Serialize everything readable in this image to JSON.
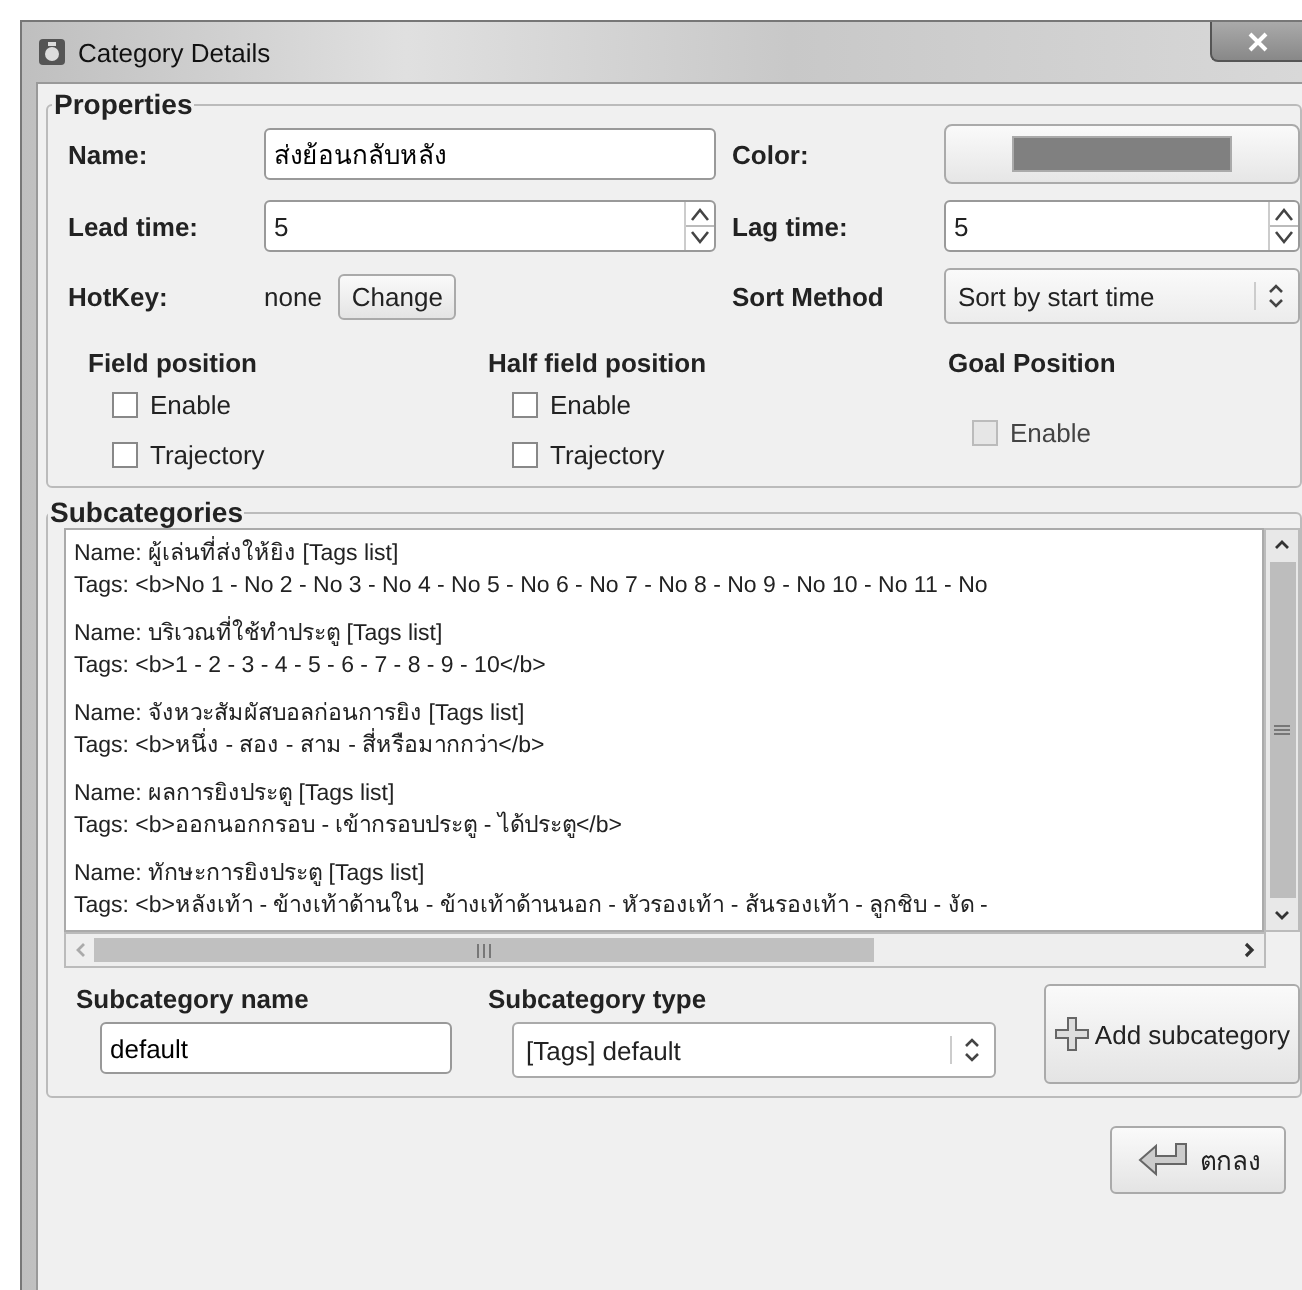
{
  "window": {
    "title": "Category Details"
  },
  "properties": {
    "legend": "Properties",
    "name": {
      "label": "Name:",
      "value": "ส่งย้อนกลับหลัง"
    },
    "color": {
      "label": "Color:",
      "color": "#808080"
    },
    "lead_time": {
      "label": "Lead time:",
      "value": "5"
    },
    "lag_time": {
      "label": "Lag time:",
      "value": "5"
    },
    "hotkey": {
      "label": "HotKey:",
      "value": "none",
      "button": "Change"
    },
    "sort_method": {
      "label": "Sort Method",
      "value": "Sort by start time"
    },
    "positions": [
      {
        "title": "Field position",
        "options": [
          {
            "label": "Enable",
            "checked": false,
            "disabled": false
          },
          {
            "label": "Trajectory",
            "checked": false,
            "disabled": false
          }
        ]
      },
      {
        "title": "Half field position",
        "options": [
          {
            "label": "Enable",
            "checked": false,
            "disabled": false
          },
          {
            "label": "Trajectory",
            "checked": false,
            "disabled": false
          }
        ]
      },
      {
        "title": "Goal Position",
        "options": [
          {
            "label": "Enable",
            "checked": false,
            "disabled": true
          }
        ]
      }
    ]
  },
  "subcategories": {
    "legend": "Subcategories",
    "items": [
      {
        "name_line": "Name: ผู้เล่นที่ส่งให้ยิง [Tags list]",
        "tags_line": "Tags: <b>No 1 - No 2 - No 3 - No 4 - No 5 - No 6 - No 7 - No 8 - No 9 - No 10 - No 11 - No"
      },
      {
        "name_line": "Name: บริเวณที่ใช้ทำประตู [Tags list]",
        "tags_line": "Tags: <b>1  - 2 - 3 - 4 - 5 - 6 - 7 - 8 - 9 - 10</b>"
      },
      {
        "name_line": "Name: จังหวะสัมผัสบอลก่อนการยิง [Tags list]",
        "tags_line": "Tags: <b>หนึ่ง  - สอง - สาม - สี่หรือมากกว่า</b>"
      },
      {
        "name_line": "Name: ผลการยิงประตู [Tags list]",
        "tags_line": "Tags: <b>ออกนอกกรอบ - เข้ากรอบประตู - ได้ประตู</b>"
      },
      {
        "name_line": "Name: ทักษะการยิงประตู [Tags list]",
        "tags_line": "Tags: <b>หลังเท้า - ข้างเท้าด้านใน - ข้างเท้าด้านนอก - หัวรองเท้า - ส้นรองเท้า - ลูกชิบ - งัด -"
      }
    ],
    "name_field": {
      "label": "Subcategory name",
      "value": "default"
    },
    "type_field": {
      "label": "Subcategory type",
      "value": "[Tags] default"
    },
    "add_button": "Add subcategory"
  },
  "ok_button": "ตกลง"
}
